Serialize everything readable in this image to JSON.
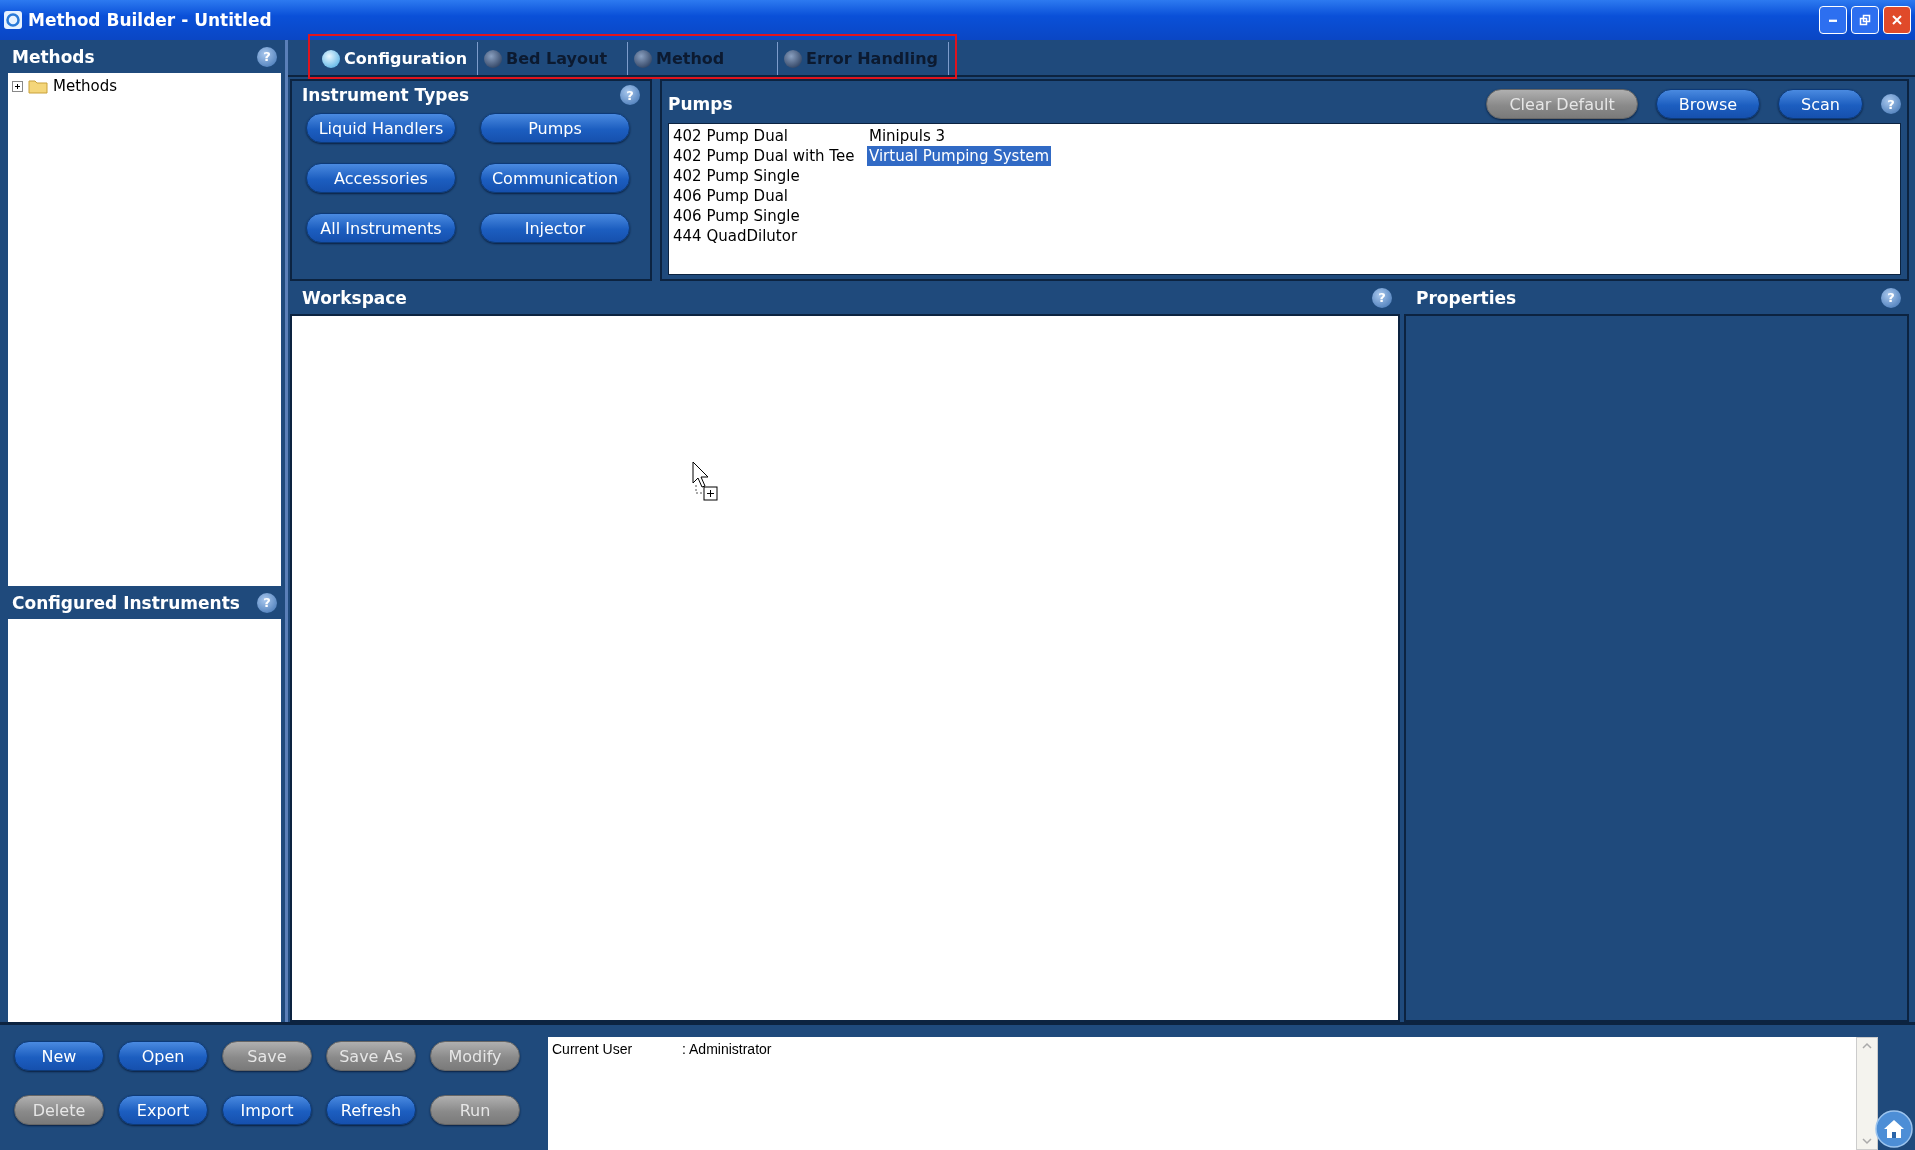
{
  "window": {
    "title": "Method Builder - Untitled"
  },
  "methods_panel": {
    "title": "Methods",
    "help": "?",
    "tree": [
      {
        "label": "Methods",
        "expanded": false
      }
    ]
  },
  "configured_panel": {
    "title": "Configured Instruments",
    "help": "?"
  },
  "tabs": [
    {
      "label": "Configuration",
      "selected": true
    },
    {
      "label": "Bed Layout",
      "selected": false
    },
    {
      "label": "Method",
      "selected": false
    },
    {
      "label": "Error Handling",
      "selected": false
    }
  ],
  "instrument_types": {
    "title": "Instrument Types",
    "help": "?",
    "buttons": [
      {
        "label": "Liquid Handlers"
      },
      {
        "label": "Pumps"
      },
      {
        "label": "Accessories"
      },
      {
        "label": "Communication"
      },
      {
        "label": "All Instruments"
      },
      {
        "label": "Injector"
      }
    ]
  },
  "pumps": {
    "title": "Pumps",
    "help": "?",
    "buttons": [
      {
        "label": "Clear Default",
        "disabled": true
      },
      {
        "label": "Browse",
        "disabled": false
      },
      {
        "label": "Scan",
        "disabled": false
      }
    ],
    "column_1": [
      {
        "label": "402 Pump Dual",
        "selected": false
      },
      {
        "label": "402 Pump Dual with Tee",
        "selected": false
      },
      {
        "label": "402 Pump Single",
        "selected": false
      },
      {
        "label": "406 Pump Dual",
        "selected": false
      },
      {
        "label": "406 Pump Single",
        "selected": false
      },
      {
        "label": "444 QuadDilutor",
        "selected": false
      }
    ],
    "column_2": [
      {
        "label": "Minipuls 3",
        "selected": false
      },
      {
        "label": "Virtual Pumping System",
        "selected": true
      }
    ]
  },
  "workspace": {
    "title": "Workspace",
    "help": "?"
  },
  "properties": {
    "title": "Properties",
    "help": "?"
  },
  "bottom_buttons": [
    {
      "label": "New",
      "disabled": false
    },
    {
      "label": "Open",
      "disabled": false
    },
    {
      "label": "Save",
      "disabled": true
    },
    {
      "label": "Save As",
      "disabled": true
    },
    {
      "label": "Modify",
      "disabled": true
    },
    {
      "label": "Delete",
      "disabled": true
    },
    {
      "label": "Export",
      "disabled": false
    },
    {
      "label": "Import",
      "disabled": false
    },
    {
      "label": "Refresh",
      "disabled": false
    },
    {
      "label": "Run",
      "disabled": true
    }
  ],
  "status_log": [
    {
      "label": "Current User",
      "value": ": Administrator"
    }
  ]
}
